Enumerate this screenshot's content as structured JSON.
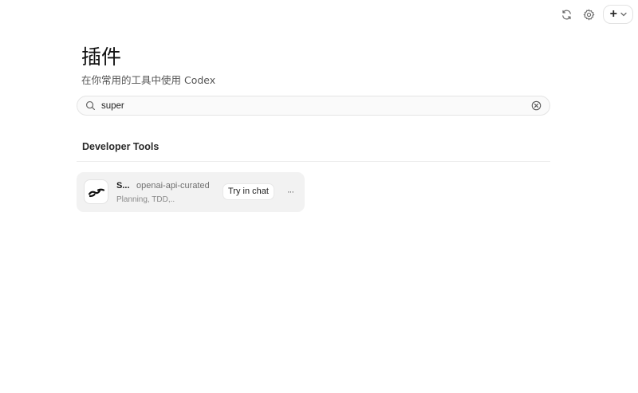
{
  "toolbar": {
    "refresh_icon": "refresh-icon",
    "settings_icon": "gear-icon",
    "new_icon": "plus-icon",
    "new_label": "+"
  },
  "header": {
    "title": "插件",
    "subtitle": "在你常用的工具中使用 Codex"
  },
  "search": {
    "value": "super",
    "placeholder": ""
  },
  "section": {
    "title": "Developer Tools"
  },
  "plugins": [
    {
      "name": "S...",
      "source": "openai-api-curated",
      "description": "Planning, TDD,..",
      "try_label": "Try in chat",
      "more_label": "···"
    }
  ]
}
